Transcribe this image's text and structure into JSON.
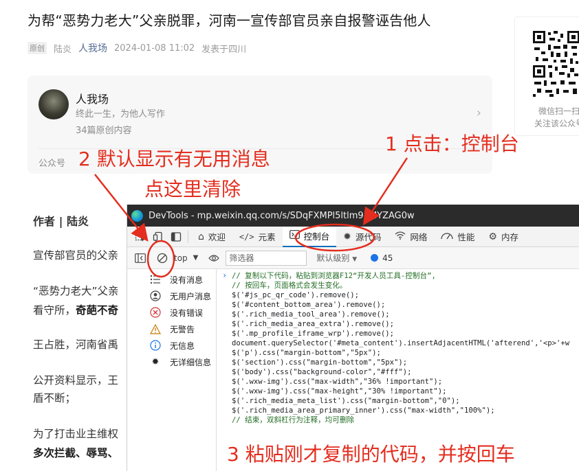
{
  "article": {
    "title": "为帮“恶势力老大”父亲脱罪，河南一宣传部官员亲自报警诬告他人",
    "meta": {
      "badge": "原创",
      "author": "陆炎",
      "account": "人我场",
      "datetime": "2024-01-08 11:02",
      "location": "发表于四川"
    },
    "profile": {
      "name": "人我场",
      "desc": "终此一生，为他人写作",
      "count": "34篇原创内容",
      "label": "公众号"
    },
    "qr": {
      "line1": "微信扫一扫",
      "line2": "关注该公众号"
    },
    "paragraphs": {
      "author_line": "作者 | 陆炎",
      "p1": "宣传部官员的父亲",
      "p2a": "“恶势力老大”父亲",
      "p2b": "看守所，",
      "p2b_bold": "奇葩不奇",
      "p3": "王占胜，河南省禹",
      "p4a": "公开资料显示，王",
      "p4b": "盾不断；",
      "p5a": "为了打击业主维权",
      "p5b_bold": "多次拦截、辱骂、"
    }
  },
  "annotations": {
    "step1": "1 点击：控制台",
    "step2_line1": "2 默认显示有无用消息",
    "step2_line2": "点这里清除",
    "step3": "3 粘贴刚才复制的代码，并按回车"
  },
  "devtools": {
    "title": "DevTools - mp.weixin.qq.com/s/SDqFXMPl5ltlm95MYZAG0w",
    "tabs": [
      {
        "label": "欢迎",
        "icon": "home-icon"
      },
      {
        "label": "元素",
        "icon": "code-icon"
      },
      {
        "label": "控制台",
        "icon": "console-icon"
      },
      {
        "label": "源代码",
        "icon": "bug-icon"
      },
      {
        "label": "网络",
        "icon": "wifi-icon"
      },
      {
        "label": "性能",
        "icon": "performance-icon"
      },
      {
        "label": "内存",
        "icon": "memory-icon"
      }
    ],
    "active_tab": "控制台",
    "toolbar": {
      "context": "top",
      "filter_placeholder": "筛选器",
      "level": "默认级别",
      "count": "45"
    },
    "sidebar": [
      {
        "label": "没有消息",
        "icon": "list-icon"
      },
      {
        "label": "无用户消息",
        "icon": "user-icon"
      },
      {
        "label": "没有错误",
        "icon": "error-icon"
      },
      {
        "label": "无警告",
        "icon": "warning-icon"
      },
      {
        "label": "无信息",
        "icon": "info-icon"
      },
      {
        "label": "无详细信息",
        "icon": "verbose-icon"
      }
    ],
    "code_lines": [
      "// 复制以下代码，粘贴到浏览器F12“开发人员工具-控制台”,",
      "// 按回车，页面格式会发生变化。",
      "$('#js_pc_qr_code').remove();",
      "$('#content_bottom_area').remove();",
      "$('.rich_media_tool_area').remove();",
      "$('.rich_media_area_extra').remove();",
      "$('.mp_profile_iframe_wrp').remove();",
      "document.querySelector('#meta_content').insertAdjacentHTML('afterend','<p>'+w",
      "$('p').css(\"margin-bottom\",\"5px\");",
      "$('section').css(\"margin-bottom\",\"5px\");",
      "$('body').css(\"background-color\",\"#fff\");",
      "$('.wxw-img').css(\"max-width\",\"36% !important\");",
      "$('.wxw-img').css(\"max-height\",\"30% !important\");",
      "$('.rich_media_meta_list').css(\"margin-bottom\",\"0\");",
      "$('.rich_media_area_primary_inner').css(\"max-width\",\"100%\");",
      "// 结束，双斜杠行为注释，均可删除"
    ]
  },
  "colors": {
    "annotation_red": "#e42d1e",
    "link_blue": "#576b95",
    "devtools_titlebar": "#2b2b2b",
    "accent_blue": "#0f6cbd"
  }
}
